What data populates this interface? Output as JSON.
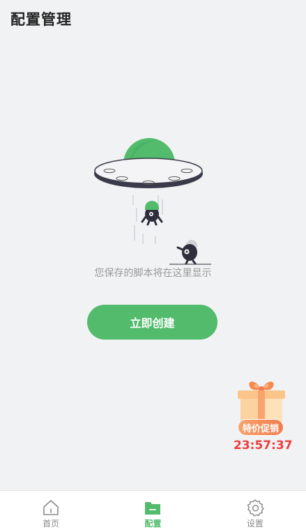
{
  "header": {
    "title": "配置管理"
  },
  "empty_state": {
    "message": "您保存的脚本将在这里显示",
    "create_button_label": "立即创建"
  },
  "promo": {
    "badge_label": "特价促销",
    "countdown": "23:57:37"
  },
  "tabbar": {
    "tabs": [
      {
        "label": "首页",
        "icon": "home-icon",
        "active": false
      },
      {
        "label": "配置",
        "icon": "folder-icon",
        "active": true
      },
      {
        "label": "设置",
        "icon": "gear-icon",
        "active": false
      }
    ]
  },
  "colors": {
    "accent": "#52bb6c",
    "countdown": "#ef3b3b",
    "background": "#f1f2f4"
  }
}
